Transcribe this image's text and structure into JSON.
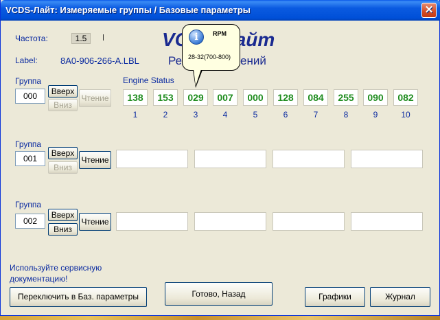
{
  "window": {
    "title": "VCDS-Лайт: Измеряемые группы / Базовые параметры",
    "close_glyph": "✕"
  },
  "header": {
    "freq_label": "Частота:",
    "freq_value": "1.5",
    "label_caption": "Label:",
    "label_value": "8A0-906-266-A.LBL",
    "big_title": "VCDS-Лайт",
    "sub_title": "Режим измерений"
  },
  "tooltip": {
    "icon": "info-icon",
    "title": "RPM",
    "text": "28-32(700-800)"
  },
  "groups": [
    {
      "caption": "Группа",
      "number": "000",
      "up_label": "Вверх",
      "down_label": "Вниз",
      "read_label": "Чтение",
      "down_disabled": true,
      "read_disabled": true
    },
    {
      "caption": "Группа",
      "number": "001",
      "up_label": "Вверх",
      "down_label": "Вниз",
      "read_label": "Чтение",
      "down_disabled": true,
      "read_disabled": false
    },
    {
      "caption": "Группа",
      "number": "002",
      "up_label": "Вверх",
      "down_label": "Вниз",
      "read_label": "Чтение",
      "down_disabled": false,
      "read_disabled": false
    }
  ],
  "engine_status": {
    "label": "Engine Status",
    "values": [
      "138",
      "153",
      "029",
      "007",
      "000",
      "128",
      "084",
      "255",
      "090",
      "082"
    ],
    "indices": [
      "1",
      "2",
      "3",
      "4",
      "5",
      "6",
      "7",
      "8",
      "9",
      "10"
    ],
    "value_color": "#1e8c1e"
  },
  "footer": {
    "note": "Используйте сервисную документацию!",
    "switch_button": "Переключить в Баз. параметры",
    "done_button": "Готово, Назад",
    "graphs_button": "Графики",
    "log_button": "Журнал"
  }
}
